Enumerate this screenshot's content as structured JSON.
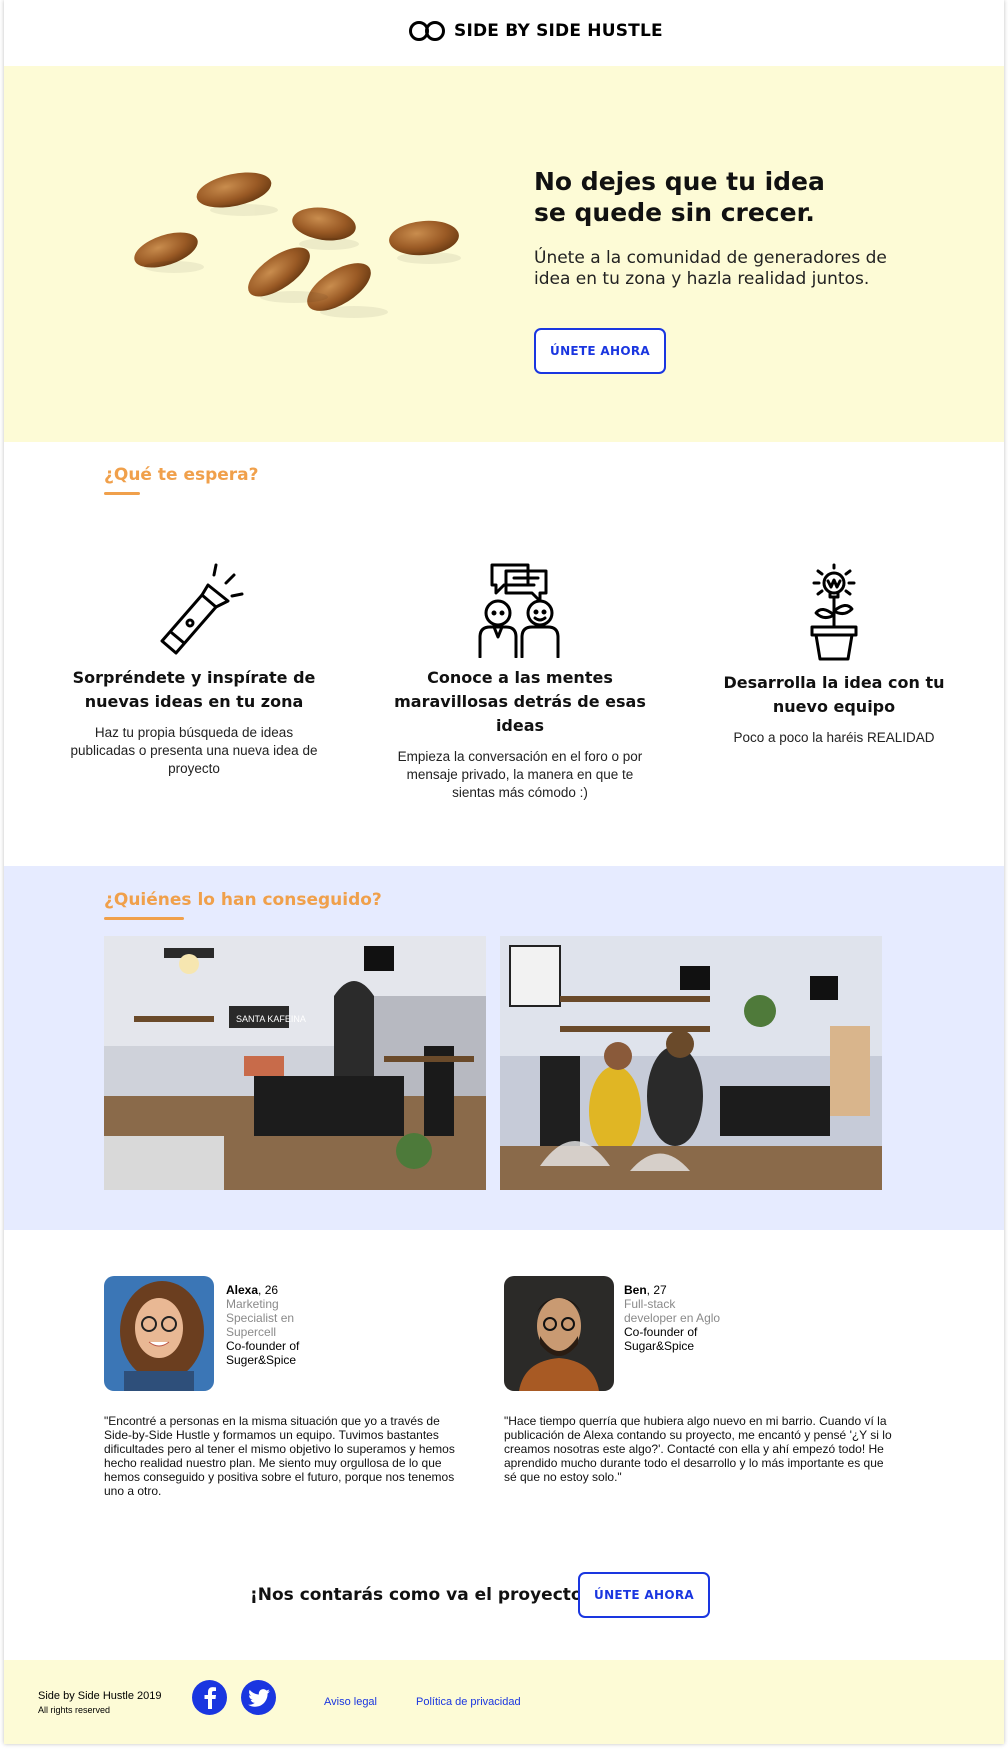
{
  "header": {
    "brand": "SIDE BY SIDE HUSTLE",
    "logo_icon": "infinity-rings-icon"
  },
  "hero": {
    "title_line1": "No dejes que tu idea",
    "title_line2": "se quede sin crecer.",
    "subtitle": "Únete a la comunidad de generadores de idea en tu zona y hazla realidad juntos.",
    "cta": "ÚNETE AHORA"
  },
  "features_section": {
    "heading": "¿Qué te espera?",
    "items": [
      {
        "icon": "flashlight-icon",
        "title": "Sorpréndete y inspírate de nuevas ideas en tu zona",
        "desc": "Haz tu propia búsqueda de ideas publicadas o presenta una nueva idea de proyecto"
      },
      {
        "icon": "people-chat-icon",
        "title": "Conoce a las mentes maravillosas detrás de esas ideas",
        "desc": "Empieza la conversación en el foro o por mensaje privado, la manera en que te sientas más cómodo :)"
      },
      {
        "icon": "idea-plant-icon",
        "title": "Desarrolla la idea con tu nuevo equipo",
        "desc": "Poco a poco la haréis REALIDAD"
      }
    ]
  },
  "stories_section": {
    "heading": "¿Quiénes lo han conseguido?",
    "photo_sign": "SANTA KAFEINA"
  },
  "testimonials": [
    {
      "name": "Alexa",
      "age": ", 26",
      "role": "Marketing Specialist en Supercell",
      "company": "Co-founder of Suger&Spice",
      "quote": "\"Encontré a personas en la misma situación que yo a través de Side-by-Side Hustle y formamos un equipo. Tuvimos bastantes dificultades pero al tener el mismo objetivo lo superamos y hemos hecho realidad nuestro plan. Me siento muy orgullosa de lo que hemos conseguido y positiva sobre el futuro, porque nos tenemos uno a otro."
    },
    {
      "name": "Ben",
      "age": ", 27",
      "role": "Full-stack developer en Aglo",
      "company": "Co-founder of Sugar&Spice",
      "quote": "\"Hace tiempo querría que hubiera algo nuevo en mi barrio. Cuando ví la publicación de Alexa contando su proyecto, me encantó y pensé '¿Y si lo creamos nosotras este algo?'. Contacté con ella y ahí empezó todo! He aprendido mucho durante todo el desarrollo y lo más importante es que sé que no estoy solo.\""
    }
  ],
  "cta": {
    "text": "¡Nos contarás como va el proyecto!",
    "button": "ÚNETE AHORA"
  },
  "footer": {
    "copyright": "Side by Side Hustle 2019",
    "rights": "All rights reserved",
    "facebook_icon": "facebook-icon",
    "twitter_icon": "twitter-icon",
    "legal": "Aviso legal",
    "privacy": "Política de privacidad"
  },
  "colors": {
    "accent": "#1a36e0",
    "orange": "#f0a04b",
    "hero_bg": "#fdfbd6",
    "stories_bg": "#e6ebff"
  }
}
